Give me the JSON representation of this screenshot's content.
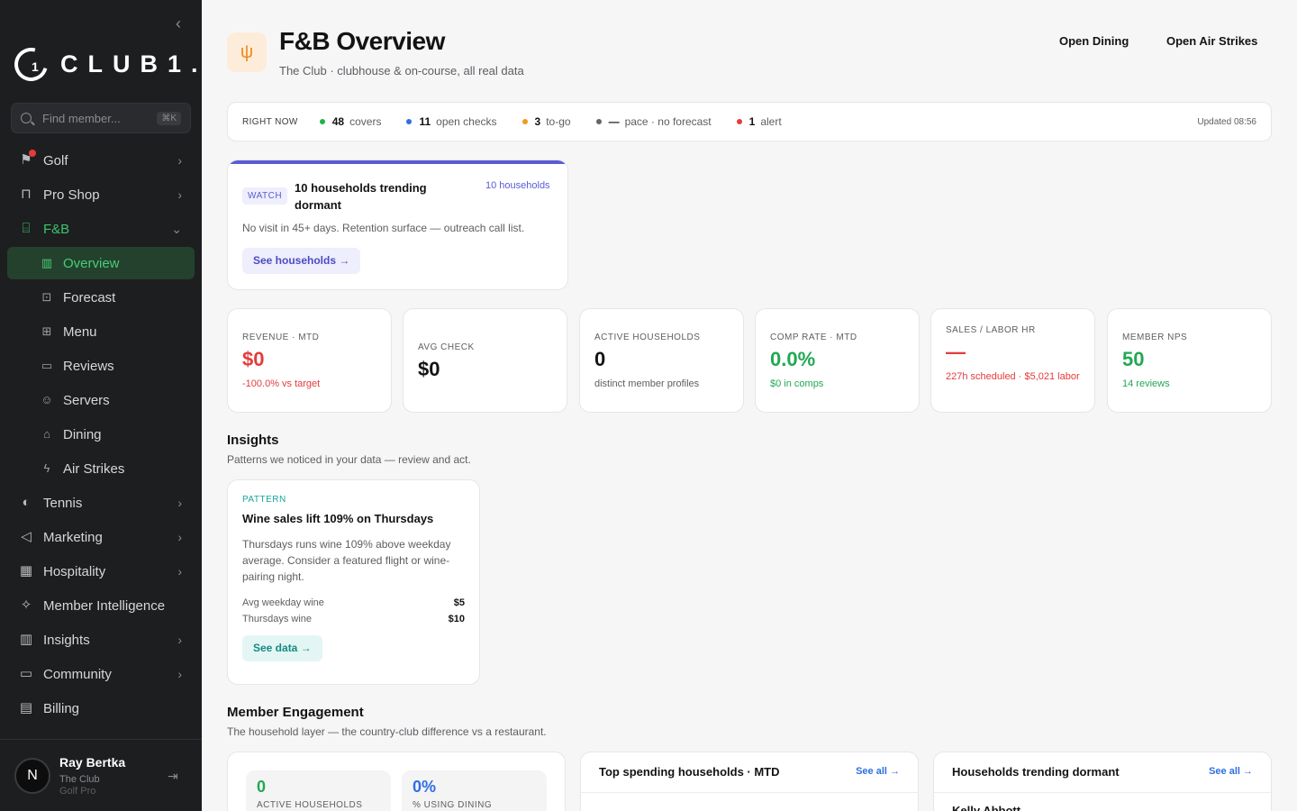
{
  "sidebar": {
    "logo_text": "CLUB1.",
    "logo_mark": "1",
    "search": {
      "placeholder": "Find member...",
      "shortcut": "⌘K"
    },
    "items": [
      {
        "label": "Golf",
        "icon": "flag-icon",
        "chevron": "›",
        "badge": true
      },
      {
        "label": "Pro Shop",
        "icon": "shopping-bag-icon",
        "chevron": "›"
      },
      {
        "label": "F&B",
        "icon": "utensils-icon",
        "chevron": "⌄"
      },
      {
        "label": "Overview",
        "icon": "bar-chart-icon"
      },
      {
        "label": "Forecast",
        "icon": "presentation-icon"
      },
      {
        "label": "Menu",
        "icon": "book-icon"
      },
      {
        "label": "Reviews",
        "icon": "message-icon"
      },
      {
        "label": "Servers",
        "icon": "users-icon"
      },
      {
        "label": "Dining",
        "icon": "cake-icon"
      },
      {
        "label": "Air Strikes",
        "icon": "lightning-icon"
      },
      {
        "label": "Tennis",
        "icon": "tennis-ball-icon",
        "chevron": "›"
      },
      {
        "label": "Marketing",
        "icon": "megaphone-icon",
        "chevron": "›"
      },
      {
        "label": "Hospitality",
        "icon": "building-icon",
        "chevron": "›"
      },
      {
        "label": "Member Intelligence",
        "icon": "sparkles-icon"
      },
      {
        "label": "Insights",
        "icon": "bar-chart-icon",
        "chevron": "›"
      },
      {
        "label": "Community",
        "icon": "chat-bubble-icon",
        "chevron": "›"
      },
      {
        "label": "Billing",
        "icon": "file-icon"
      }
    ],
    "user": {
      "initial": "N",
      "name": "Ray Bertka",
      "club": "The Club",
      "role": "Golf Pro"
    }
  },
  "header": {
    "title": "F&B Overview",
    "subtitle": "The Club · clubhouse & on-course, all real data",
    "icon": "utensils-icon",
    "buttons": {
      "open_dining": "Open Dining",
      "open_air_strikes": "Open Air Strikes"
    }
  },
  "right_now": {
    "label": "RIGHT NOW",
    "items": [
      {
        "value": "48",
        "text": "covers",
        "color": "#22b14c"
      },
      {
        "value": "11",
        "text": "open checks",
        "color": "#2f6fe0"
      },
      {
        "value": "3",
        "text": "to-go",
        "color": "#f29a1f"
      },
      {
        "value": "—",
        "text": "pace · no forecast",
        "color": "#666666"
      },
      {
        "value": "1",
        "text": "alert",
        "color": "#e53b3b"
      }
    ],
    "updated": "Updated 08:56"
  },
  "watch": {
    "tag": "WATCH",
    "title": "10 households trending dormant",
    "count": "10 households",
    "description": "No visit in 45+ days. Retention surface — outreach call list.",
    "button": "See households →"
  },
  "kpis": [
    {
      "label": "REVENUE · MTD",
      "value": "$0",
      "sub": "-100.0% vs target",
      "value_color": "#e53b3b",
      "sub_color": "#e53b3b"
    },
    {
      "label": "AVG CHECK",
      "value": "$0",
      "sub": "",
      "value_color": "#131313",
      "sub_color": "#5d5e62"
    },
    {
      "label": "ACTIVE HOUSEHOLDS",
      "value": "0",
      "sub": "distinct member profiles",
      "value_color": "#131313",
      "sub_color": "#5d5e62"
    },
    {
      "label": "COMP RATE · MTD",
      "value": "0.0%",
      "sub": "$0 in comps",
      "value_color": "#22a853",
      "sub_color": "#22a853"
    },
    {
      "label": "SALES / LABOR HR",
      "value": "—",
      "sub": "227h scheduled · $5,021 labor",
      "value_color": "#e53b3b",
      "sub_color": "#e53b3b"
    },
    {
      "label": "MEMBER NPS",
      "value": "50",
      "sub": "14 reviews",
      "value_color": "#22a853",
      "sub_color": "#22a853"
    }
  ],
  "insights": {
    "title": "Insights",
    "subtitle": "Patterns we noticed in your data — review and act.",
    "card": {
      "tag": "PATTERN",
      "title": "Wine sales lift 109% on Thursdays",
      "description": "Thursdays runs wine 109% above weekday average. Consider a featured flight or wine-pairing night.",
      "rows": [
        {
          "label": "Avg weekday wine",
          "value": "$5"
        },
        {
          "label": "Thursdays wine",
          "value": "$10"
        }
      ],
      "button": "See data →"
    }
  },
  "engagement": {
    "title": "Member Engagement",
    "subtitle": "The household layer — the country-club difference vs a restaurant.",
    "stats": [
      {
        "value": "0",
        "label": "ACTIVE HOUSEHOLDS",
        "color": "#22a853"
      },
      {
        "value": "0%",
        "label": "% USING DINING",
        "color": "#2f6fe0"
      }
    ],
    "top_spending": {
      "title": "Top spending households · MTD",
      "link": "See all →"
    },
    "dormant": {
      "title": "Households trending dormant",
      "link": "See all →",
      "first_row": "Kelly Abbott"
    }
  }
}
